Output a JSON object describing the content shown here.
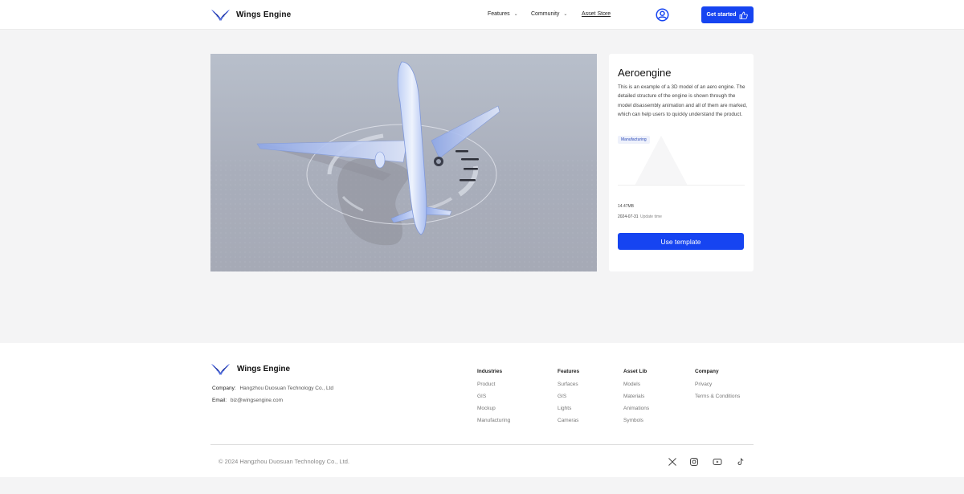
{
  "brand": {
    "name": "Wings Engine"
  },
  "header": {
    "nav": [
      {
        "label": "Features"
      },
      {
        "label": "Community"
      },
      {
        "label": "Asset Store"
      }
    ],
    "cta_label": "Get started"
  },
  "card": {
    "title": "Aeroengine",
    "description": "This is an example of a 3D model of an aero engine. The detailed structure of the engine is shown through the model disassembly animation and all of them are marked, which can help users to quickly understand the product.",
    "tag": "Manufacturing",
    "size": "14.47MB",
    "date": "2024-07-31",
    "date_label": "Update time",
    "button_label": "Use template"
  },
  "footer": {
    "company_label": "Company:",
    "company_value": "Hangzhou Duosuan Technology Co., Ltd",
    "email_label": "Email:",
    "email_value": "biz@wingsengine.com",
    "columns": [
      {
        "title": "Industries",
        "links": [
          "Product",
          "GIS",
          "Mockup",
          "Manufacturing"
        ]
      },
      {
        "title": "Features",
        "links": [
          "Surfaces",
          "GIS",
          "Lights",
          "Cameras"
        ]
      },
      {
        "title": "Asset Lib",
        "links": [
          "Models",
          "Materials",
          "Animations",
          "Symbols"
        ]
      },
      {
        "title": "Company",
        "links": [
          "Privacy",
          "Terms & Conditions"
        ]
      }
    ],
    "copyright": "© 2024 Hangzhou Duosuan Technology Co., Ltd.",
    "social": [
      "x-icon",
      "instagram-icon",
      "youtube-icon",
      "tiktok-icon"
    ]
  },
  "colors": {
    "accent": "#1644f1",
    "page_bg": "#f4f4f5"
  }
}
